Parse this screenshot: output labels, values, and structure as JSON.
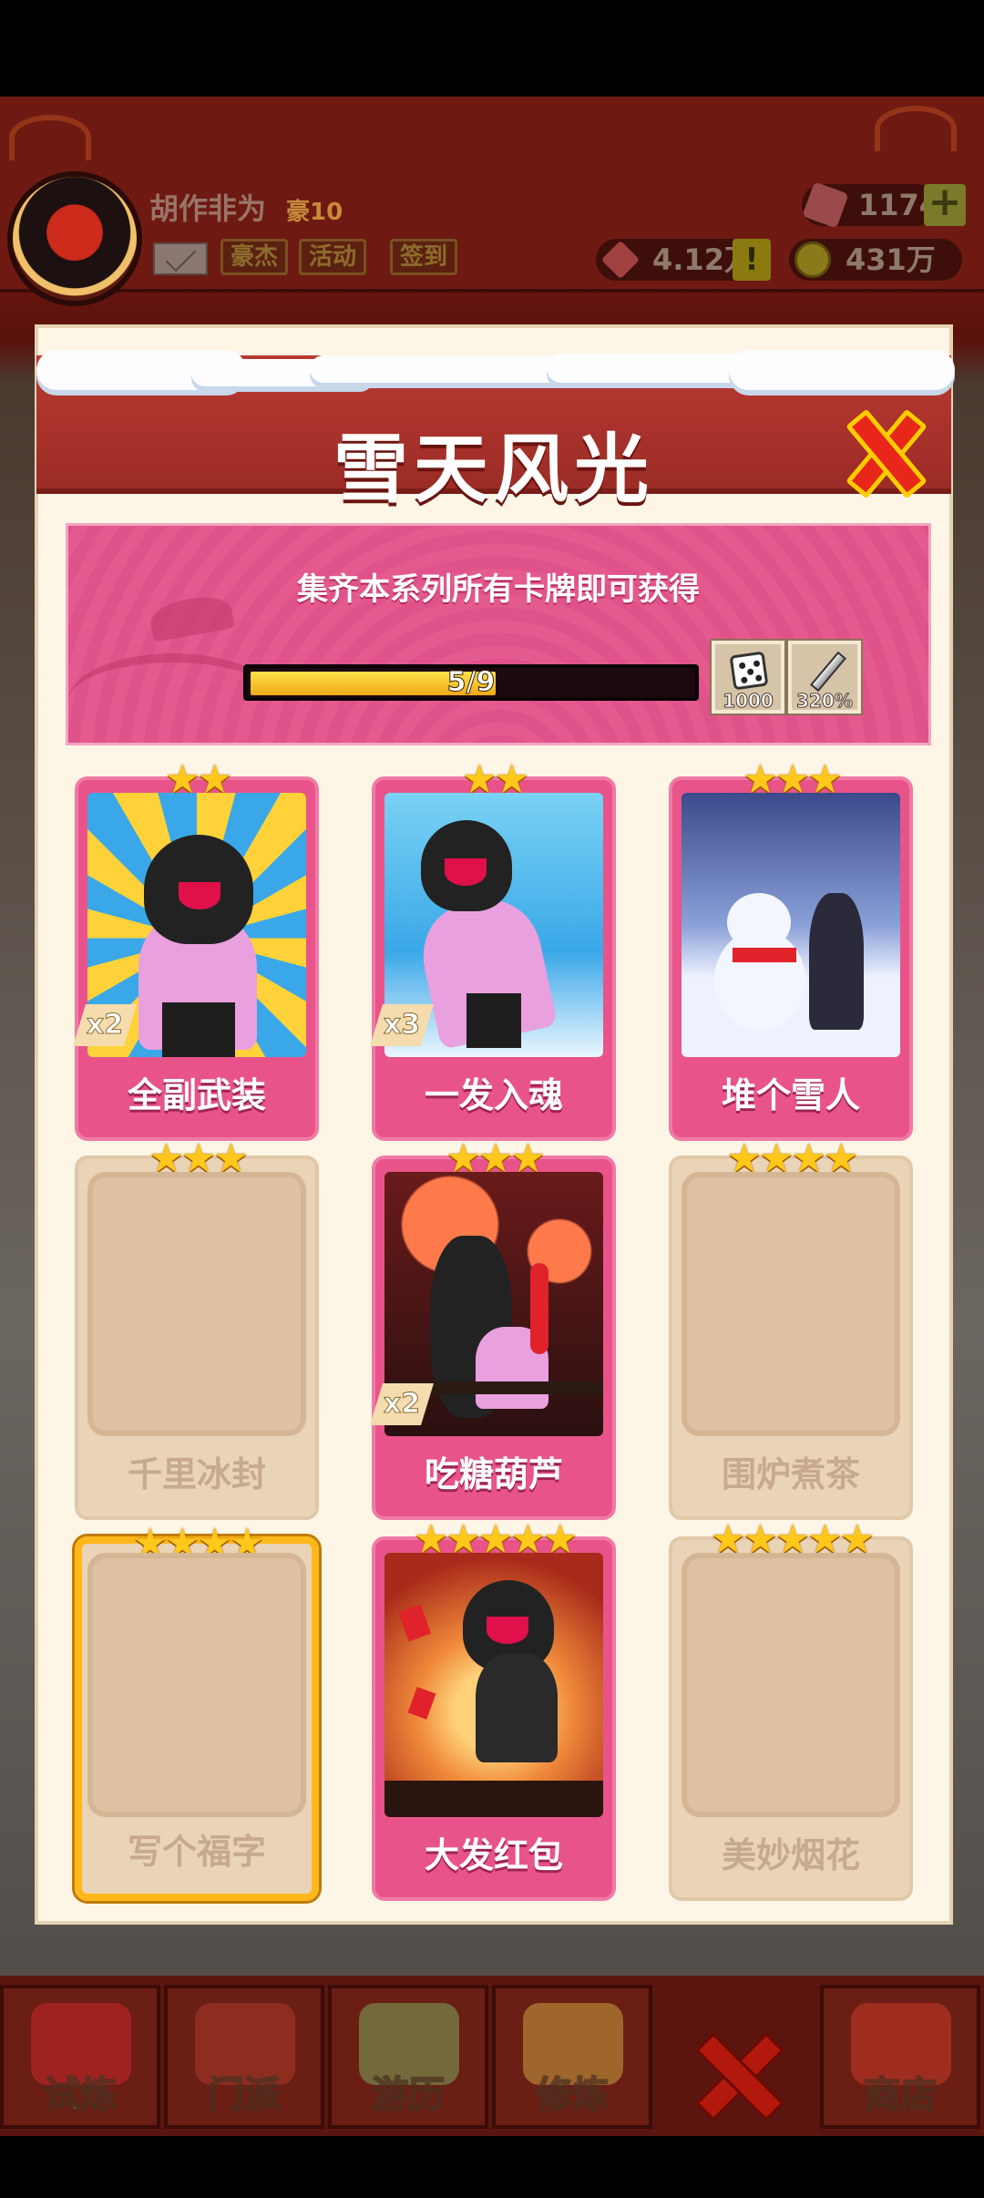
{
  "header": {
    "player_name": "胡作非为",
    "player_rank": "豪10",
    "buttons": [
      "豪杰",
      "活动",
      "签到"
    ],
    "gems": "1174",
    "power": "4.12万",
    "coins": "431万",
    "plus_icon": "+",
    "alert_icon": "!"
  },
  "modal": {
    "title": "雪天风光",
    "close_icon": "close-x-icon",
    "banner_text": "集齐本系列所有卡牌即可获得",
    "progress": {
      "text": "5/9",
      "fraction": 0.556
    },
    "rewards": [
      {
        "icon": "dice-icon",
        "label": "1000"
      },
      {
        "icon": "sword-icon",
        "label": "320%"
      }
    ]
  },
  "cards": [
    {
      "name": "全副武装",
      "stars": "★★",
      "owned": true,
      "count": "x2"
    },
    {
      "name": "一发入魂",
      "stars": "★★",
      "owned": true,
      "count": "x3"
    },
    {
      "name": "堆个雪人",
      "stars": "★★★",
      "owned": true,
      "count": ""
    },
    {
      "name": "千里冰封",
      "stars": "★★★",
      "owned": false,
      "count": ""
    },
    {
      "name": "吃糖葫芦",
      "stars": "★★★",
      "owned": true,
      "count": "x2"
    },
    {
      "name": "围炉煮茶",
      "stars": "★★★★",
      "owned": false,
      "count": ""
    },
    {
      "name": "写个福字",
      "stars": "★★★★",
      "owned": false,
      "count": ""
    },
    {
      "name": "大发红包",
      "stars": "★★★★★",
      "owned": true,
      "count": ""
    },
    {
      "name": "美妙烟花",
      "stars": "★★★★★",
      "owned": false,
      "count": ""
    }
  ],
  "bottom_nav": {
    "tabs": [
      "试炼",
      "门派",
      "游历",
      "修炼",
      "商店"
    ],
    "close_icon": "close-x-icon"
  },
  "colors": {
    "header_red": "#b83a32",
    "card_pink": "#e8548a",
    "locked_tan": "#ead4b8",
    "star_gold": "#ffc81a",
    "progress_yellow": "#ffe24a"
  }
}
